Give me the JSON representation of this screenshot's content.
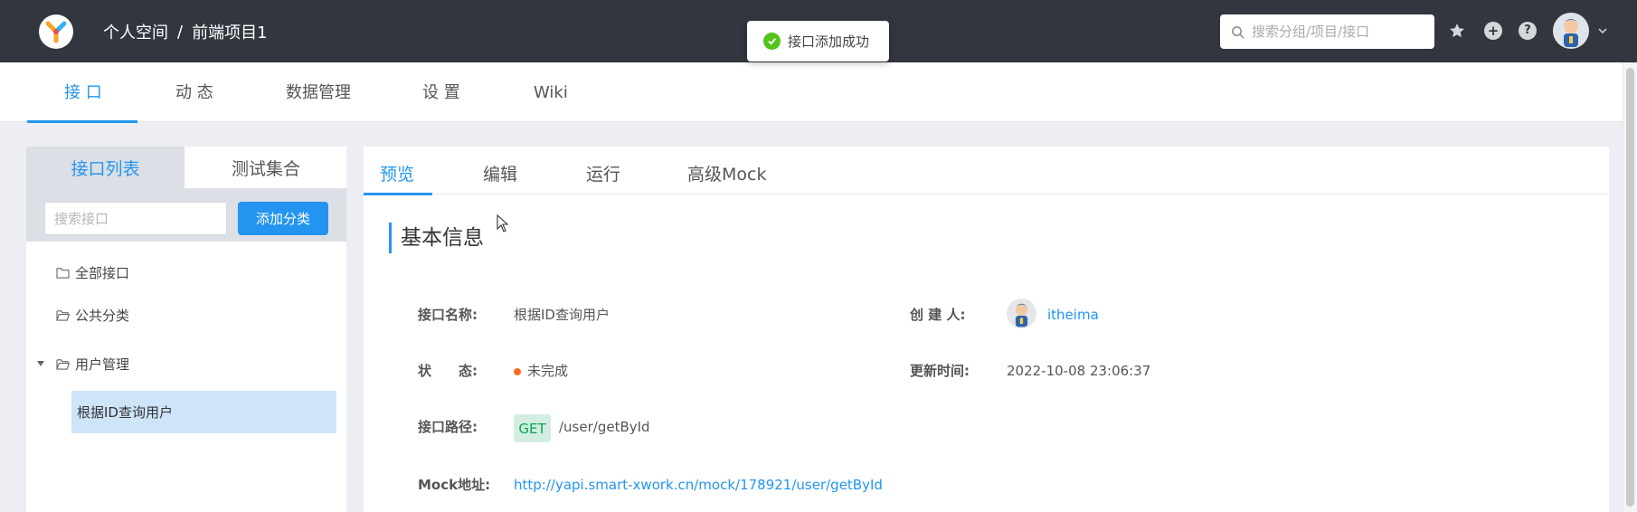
{
  "header": {
    "breadcrumb": {
      "space": "个人空间",
      "separator": "/",
      "project": "前端项目1"
    },
    "search_placeholder": "搜索分组/项目/接口",
    "icons": [
      "star-icon",
      "plus-icon",
      "help-icon"
    ]
  },
  "toast": {
    "message": "接口添加成功"
  },
  "subnav": {
    "tabs": [
      {
        "label": "接 口"
      },
      {
        "label": "动 态"
      },
      {
        "label": "数据管理"
      },
      {
        "label": "设 置"
      },
      {
        "label": "Wiki"
      }
    ]
  },
  "sidebar": {
    "tabs": [
      {
        "label": "接口列表"
      },
      {
        "label": "测试集合"
      }
    ],
    "search_placeholder": "搜索接口",
    "add_button": "添加分类",
    "tree": [
      {
        "label": "全部接口"
      },
      {
        "label": "公共分类"
      },
      {
        "label": "用户管理"
      }
    ],
    "selected_item": "根据ID查询用户"
  },
  "detail": {
    "tabs": [
      {
        "label": "预览"
      },
      {
        "label": "编辑"
      },
      {
        "label": "运行"
      },
      {
        "label": "高级Mock"
      }
    ],
    "section_title": "基本信息",
    "fields": {
      "name_label": "接口名称:",
      "name_value": "根据ID查询用户",
      "creator_label": "创 建 人:",
      "creator_value": "itheima",
      "status_label": "状　　态:",
      "status_value": "未完成",
      "updated_label": "更新时间:",
      "updated_value": "2022-10-08 23:06:37",
      "path_label": "接口路径:",
      "method": "GET",
      "path_value": "/user/getById",
      "mock_label": "Mock地址:",
      "mock_value": "http://yapi.smart-xwork.cn/mock/178921/user/getById"
    }
  },
  "colors": {
    "header_bg": "#32363f",
    "accent": "#2395f1",
    "success": "#52c41a",
    "status_incomplete": "#fa6b1c",
    "get_badge_bg": "#d3eee0",
    "get_badge_text": "#00a854"
  }
}
